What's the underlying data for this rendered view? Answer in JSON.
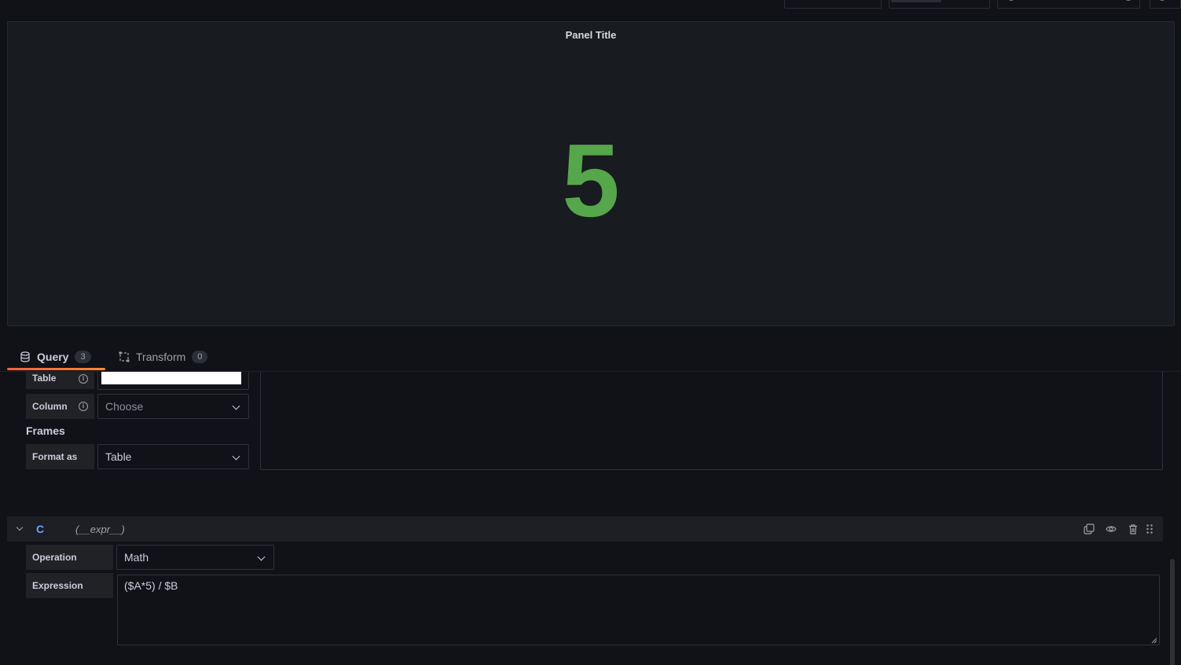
{
  "panel": {
    "title": "Panel Title",
    "value": "5",
    "value_color": "#56a64b"
  },
  "tabs": [
    {
      "label": "Query",
      "count": "3",
      "icon": "database-icon",
      "active": true
    },
    {
      "label": "Transform",
      "count": "0",
      "icon": "transform-icon",
      "active": false
    }
  ],
  "query_b": {
    "table_label": "Table",
    "table_value": "",
    "column_label": "Column",
    "column_placeholder": "Choose",
    "frames_heading": "Frames",
    "format_label": "Format as",
    "format_value": "Table"
  },
  "query_c": {
    "ref_id": "C",
    "type": "(__expr__)",
    "operation_label": "Operation",
    "operation_value": "Math",
    "expression_label": "Expression",
    "expression_value": "($A*5) / $B",
    "actions": [
      "copy-icon",
      "eye-icon",
      "trash-icon",
      "drag-handle-icon"
    ]
  },
  "colors": {
    "background": "#111217",
    "panel_bg": "#181b1f",
    "accent": "#f55f3e",
    "ref_id": "#6e9fff"
  }
}
